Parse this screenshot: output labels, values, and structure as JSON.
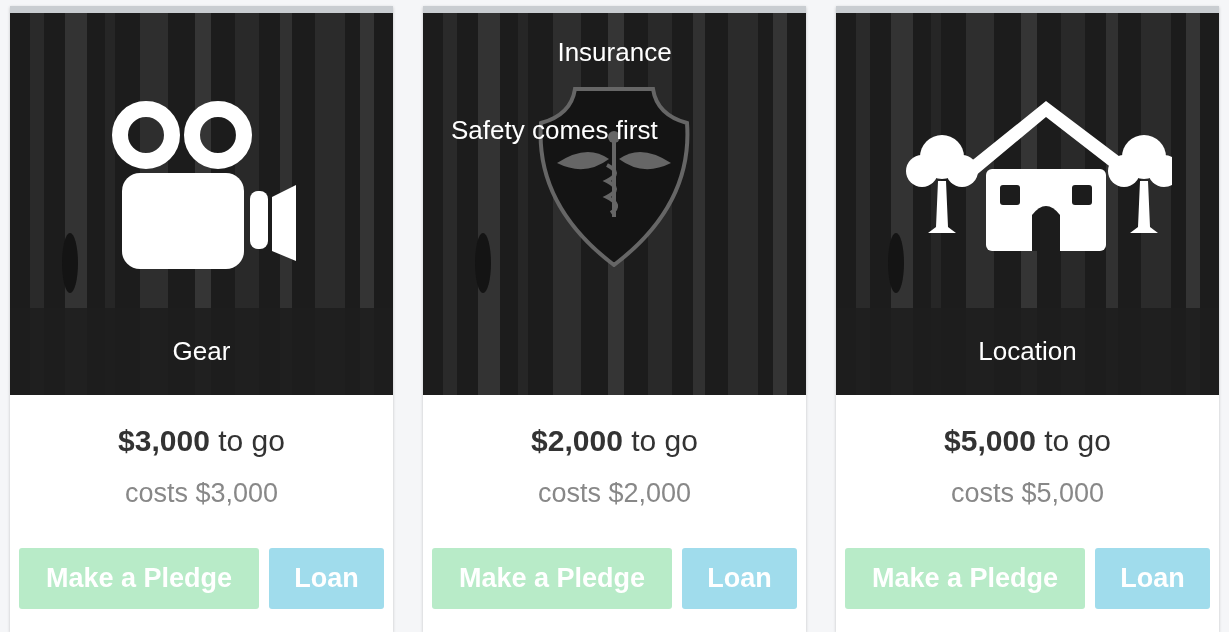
{
  "cards": [
    {
      "kind": "caption",
      "title": "Gear",
      "price": "**$3,000** to go",
      "costs": "costs $3,000",
      "buttons": [
        "Make a Pledge",
        "Loan"
      ]
    },
    {
      "kind": "overlay",
      "title": "Insurance",
      "subtitle": "Safety comes first",
      "price": "**$2,000** to go",
      "costs": "costs $2,000",
      "buttons": [
        "Make a Pledge",
        "Loan"
      ]
    },
    {
      "kind": "caption",
      "title": "Location",
      "price": "**$5,000** to go",
      "costs": "costs $5,000",
      "buttons": [
        "Make a Pledge",
        "Loan"
      ]
    }
  ]
}
